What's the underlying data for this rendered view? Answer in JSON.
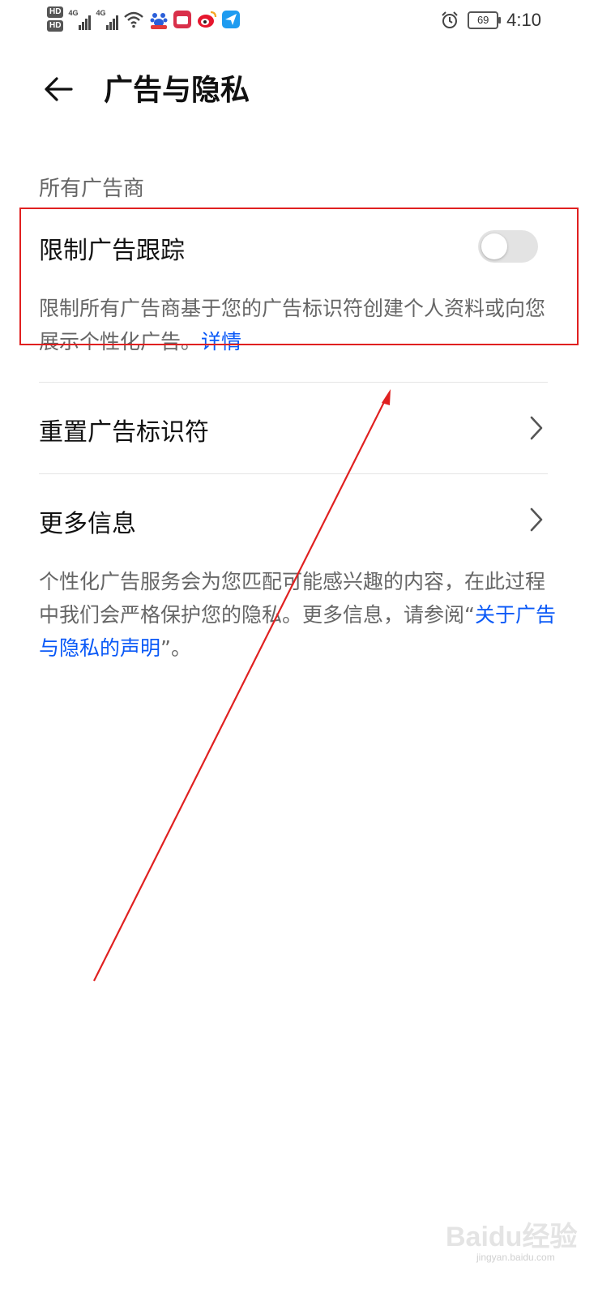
{
  "status_bar": {
    "hd1": "HD",
    "hd2": "HD",
    "net1": "4G",
    "net2": "4G",
    "battery": "69",
    "time": "4:10"
  },
  "header": {
    "title": "广告与隐私"
  },
  "section": {
    "label": "所有广告商"
  },
  "limit_tracking": {
    "title": "限制广告跟踪",
    "toggle_on": false,
    "desc": "限制所有广告商基于您的广告标识符创建个人资料或向您展示个性化广告。",
    "link": "详情"
  },
  "reset_id": {
    "title": "重置广告标识符"
  },
  "more_info": {
    "title": "更多信息",
    "desc_before": "个性化广告服务会为您匹配可能感兴趣的内容，在此过程中我们会严格保护您的隐私。更多信息，请参阅“",
    "link": "关于广告与隐私的声明",
    "desc_after": "”。"
  },
  "watermark": {
    "brand": "Baidu经验",
    "url": "jingyan.baidu.com"
  },
  "colors": {
    "link": "#0a59f7",
    "highlight": "#e02020"
  }
}
